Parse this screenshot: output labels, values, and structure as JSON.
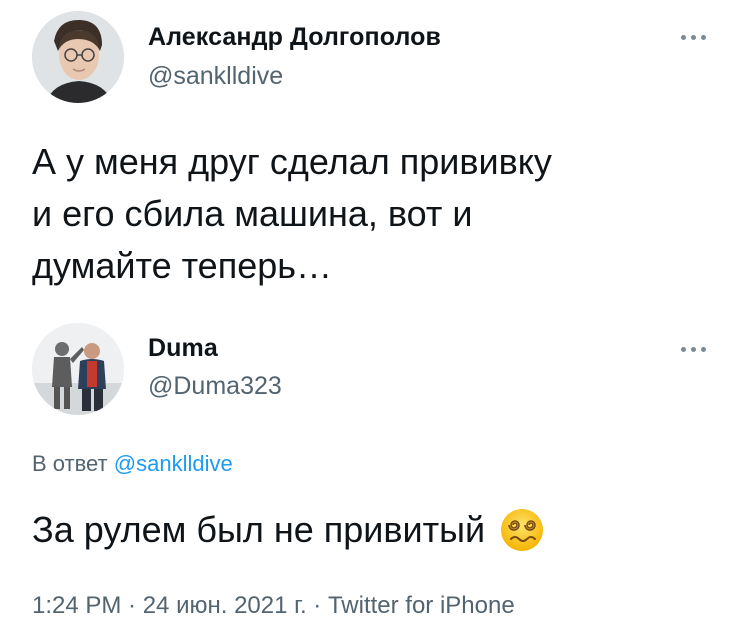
{
  "tweet": {
    "author_name": "Александр Долгополов",
    "author_handle": "@sanklldive",
    "text_lines": [
      "А у меня друг сделал прививку",
      "и его сбила машина, вот и",
      "думайте теперь…"
    ],
    "more_icon": "more-horizontal-icon"
  },
  "reply": {
    "author_name": "Duma",
    "author_handle": "@Duma323",
    "reply_prefix": "В ответ",
    "reply_handle": "@sanklldive",
    "text": "За рулем был не привитый",
    "emoji_icon": "dizzy-face-emoji",
    "timestamp": "1:24 PM · 24 июн. 2021 г. · Twitter for iPhone",
    "more_icon": "more-horizontal-icon"
  },
  "colors": {
    "text_primary": "#0f1419",
    "text_secondary": "#536471",
    "link": "#1d9bf0"
  }
}
